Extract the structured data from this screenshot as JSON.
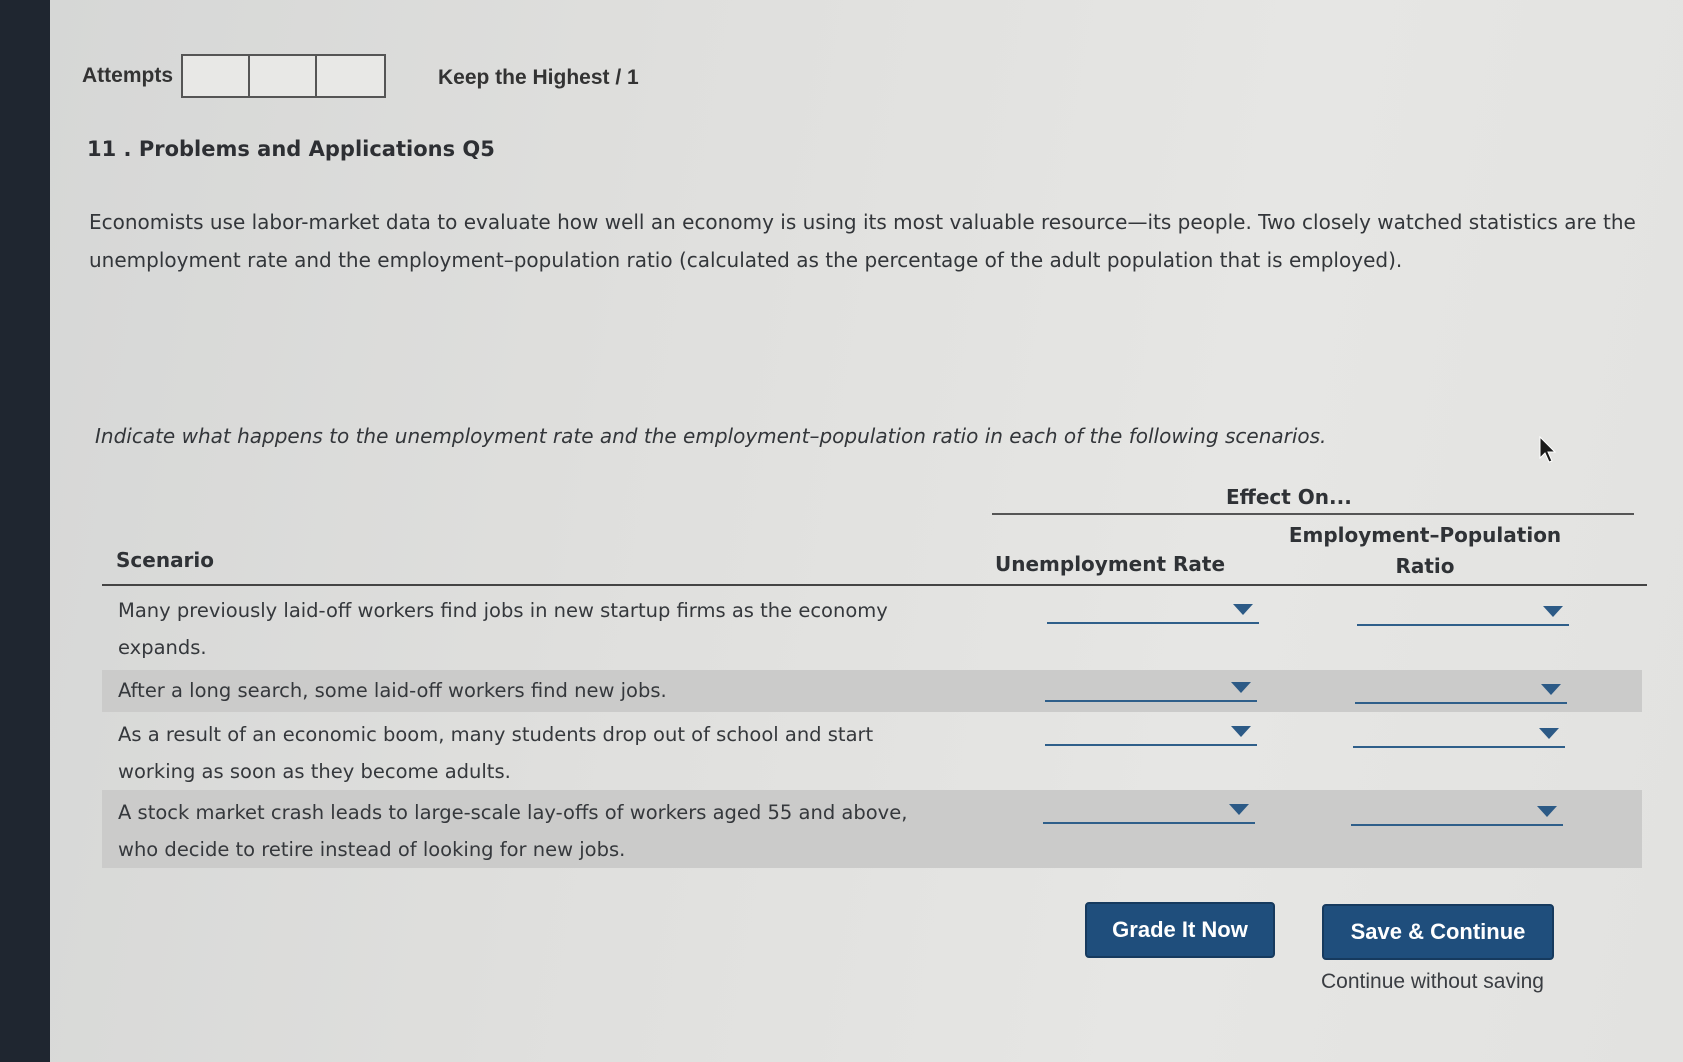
{
  "header": {
    "attempts_label": "Attempts",
    "attempt_boxes": 3,
    "keep_label": "Keep the Highest / 1"
  },
  "question": {
    "title": "11 . Problems and Applications Q5",
    "intro": "Economists use labor-market data to evaluate how well an economy is using its most valuable resource—its people. Two closely watched statistics are the unemployment rate and the employment–population ratio (calculated as the percentage of the adult population that is employed).",
    "instruction": "Indicate what happens to the unemployment rate and the employment–population ratio in each of the following scenarios."
  },
  "table": {
    "effect_on": "Effect On...",
    "col_scenario": "Scenario",
    "col_unemployment": "Unemployment Rate",
    "col_epr_line1": "Employment–Population",
    "col_epr_line2": "Ratio",
    "rows": [
      {
        "scenario": "Many previously laid-off workers find jobs in new startup firms as the economy expands.",
        "unemployment": "",
        "epr": ""
      },
      {
        "scenario": "After a long search, some laid-off workers find new jobs.",
        "unemployment": "",
        "epr": ""
      },
      {
        "scenario": "As a result of an economic boom, many students drop out of school and start working as soon as they become adults.",
        "unemployment": "",
        "epr": ""
      },
      {
        "scenario": "A stock market crash leads to large-scale lay-offs of workers aged 55 and above, who decide to retire instead of looking for new jobs.",
        "unemployment": "",
        "epr": ""
      }
    ]
  },
  "actions": {
    "grade_label": "Grade It Now",
    "save_label": "Save & Continue",
    "continue_label": "Continue without saving"
  },
  "colors": {
    "button_bg": "#1f4e7c",
    "dropdown_line": "#2f5f8a",
    "row_shade": "#cbcbca"
  }
}
